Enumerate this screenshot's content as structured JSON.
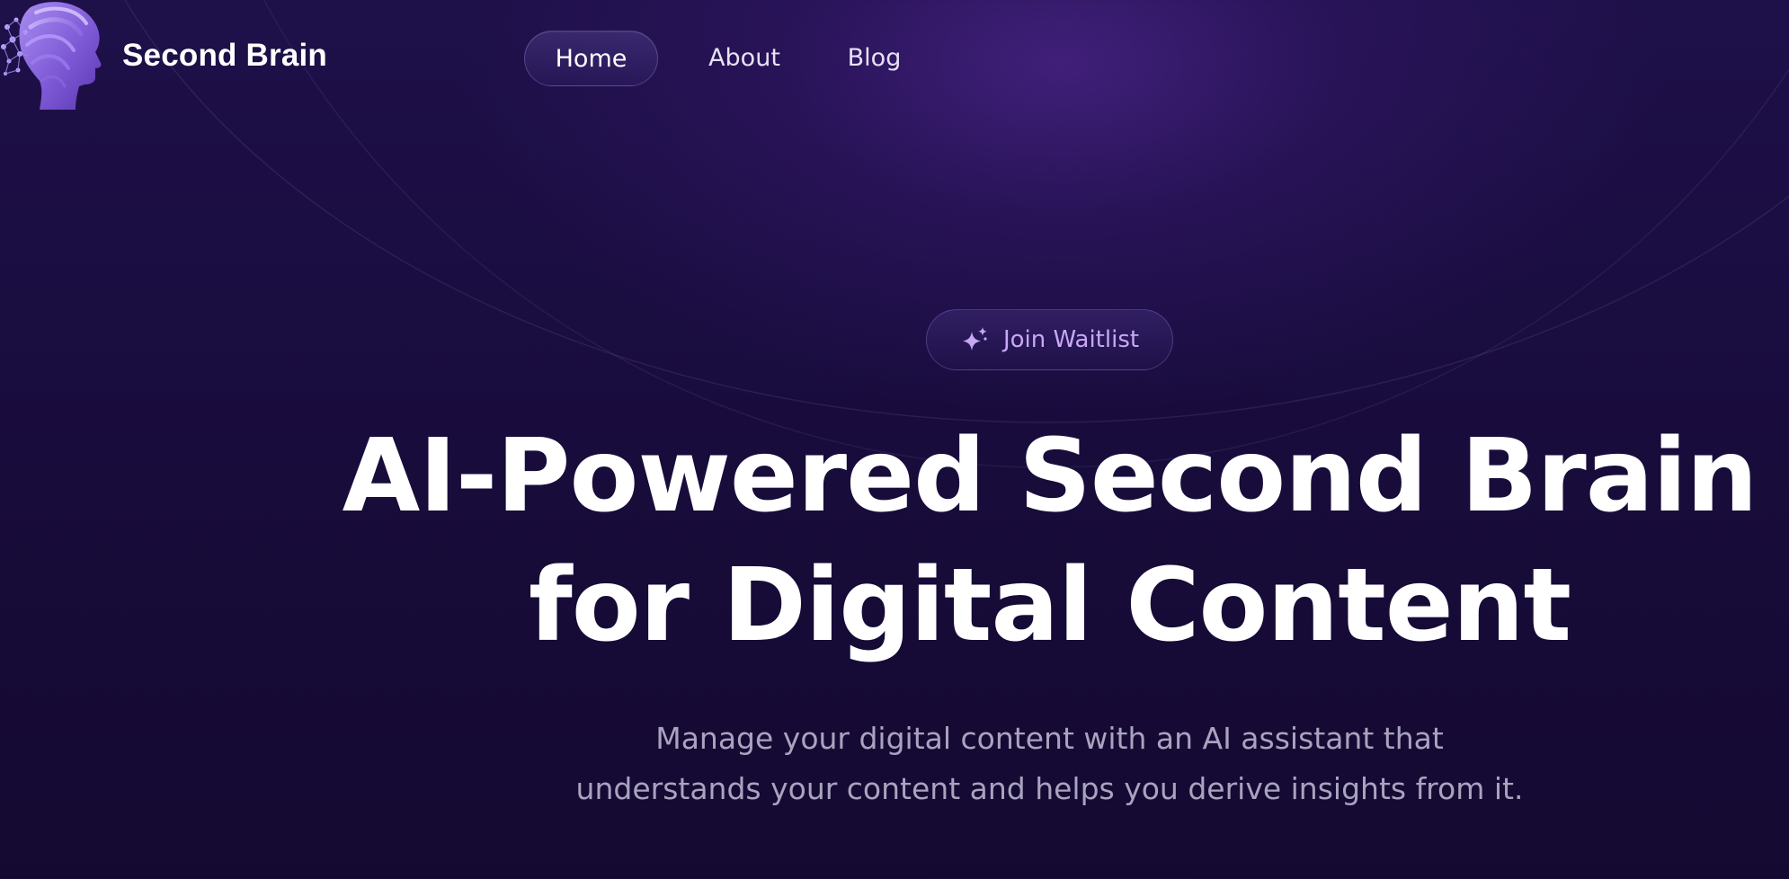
{
  "brand": {
    "name": "Second Brain",
    "logo_icon": "head-silhouette-neural-network-icon"
  },
  "nav": {
    "items": [
      {
        "label": "Home",
        "active": true
      },
      {
        "label": "About",
        "active": false
      },
      {
        "label": "Blog",
        "active": false
      }
    ]
  },
  "waitlist": {
    "label": "Join Waitlist",
    "icon": "sparkle-icon"
  },
  "hero": {
    "title_line_1": "AI-Powered Second Brain",
    "title_line_2": "for Digital Content",
    "subtitle": "Manage your digital content with an AI assistant that understands your content and helps you derive insights from it."
  },
  "colors": {
    "background": "#1a0d40",
    "accent": "#c7a8f5",
    "subtitle_text": "#a9a3bf"
  }
}
